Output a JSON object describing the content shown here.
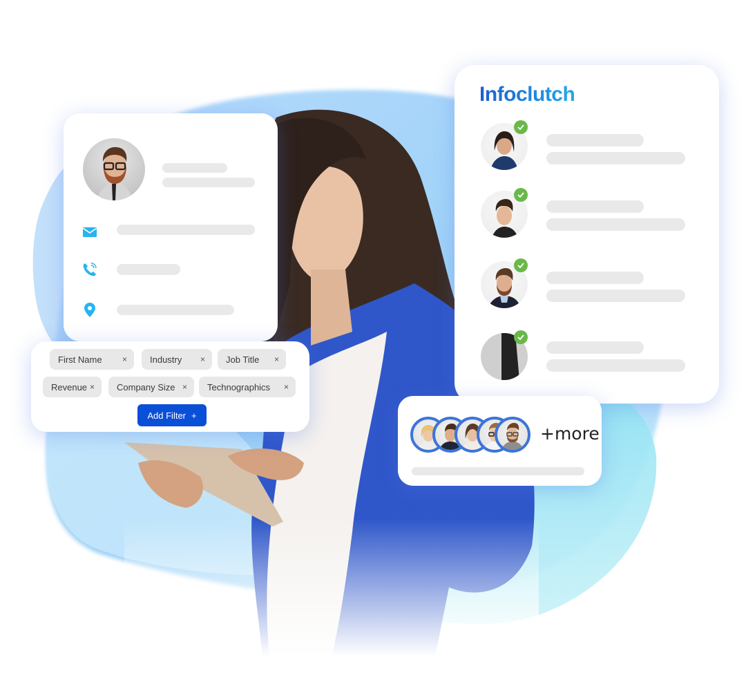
{
  "colors": {
    "brand_blue": "#1f5fd0",
    "brand_light": "#25a8ea",
    "icon_cyan": "#27b4ef",
    "verified_green": "#6ab84a",
    "button_blue": "#0a4fd8",
    "skeleton_gray": "#e9e9e9",
    "avatar_ring": "#3d74d8"
  },
  "profile_card": {
    "avatar": "profile-photo-man-glasses",
    "contacts": [
      {
        "icon": "email-icon"
      },
      {
        "icon": "phone-icon"
      },
      {
        "icon": "location-pin-icon"
      }
    ]
  },
  "list_card": {
    "brand_name": "Infoclutch",
    "items": [
      {
        "avatar": "woman-dark-hair",
        "verified": true
      },
      {
        "avatar": "man-smiling",
        "verified": true
      },
      {
        "avatar": "man-beard",
        "verified": true
      },
      {
        "avatar": "person-partial",
        "verified": true
      }
    ]
  },
  "filter_card": {
    "chips": [
      {
        "label": "First Name",
        "remove": "×"
      },
      {
        "label": "Industry",
        "remove": "×"
      },
      {
        "label": "Job Title",
        "remove": "×"
      },
      {
        "label": "Revenue",
        "remove": "×"
      },
      {
        "label": "Company Size",
        "remove": "×"
      },
      {
        "label": "Technographics",
        "remove": "×"
      }
    ],
    "add_button": {
      "label": "Add Filter",
      "icon": "+"
    }
  },
  "more_card": {
    "avatars": [
      "woman-blonde-glasses",
      "man-beard-suit",
      "woman-brown-hair",
      "man-glasses",
      "man-glasses-beard"
    ],
    "more_label": "+more"
  }
}
